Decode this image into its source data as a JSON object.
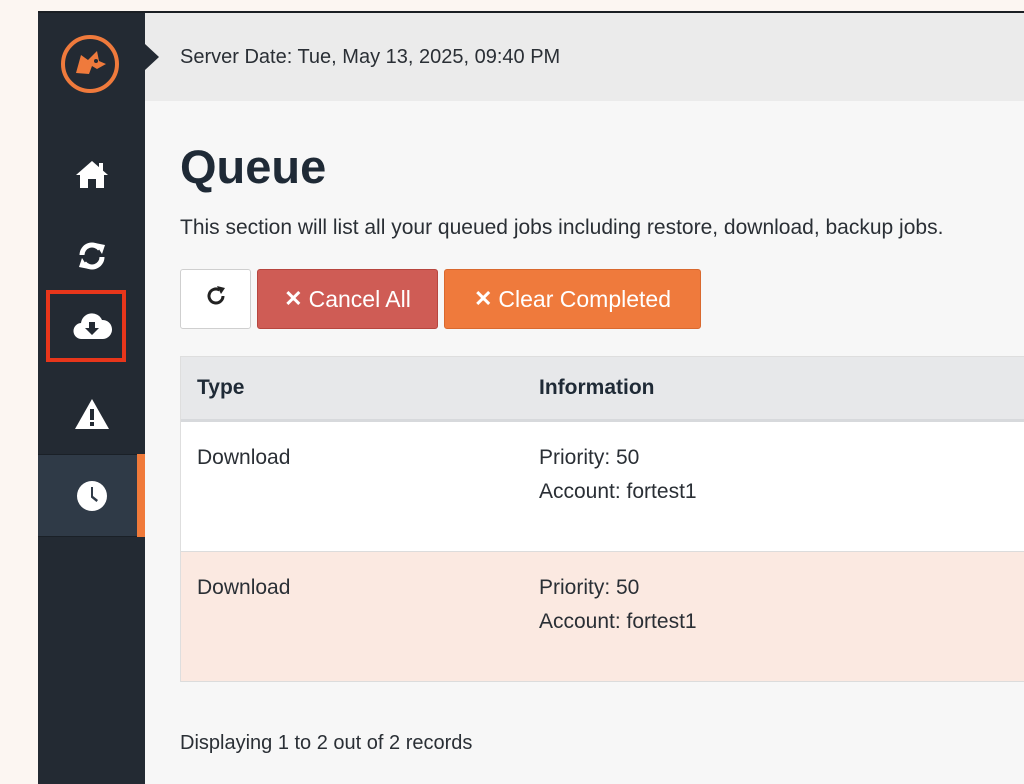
{
  "header": {
    "server_date": "Server Date: Tue, May 13, 2025, 09:40 PM"
  },
  "sidebar": {
    "logo_icon": "fox-logo-icon",
    "items": [
      {
        "icon": "home-icon"
      },
      {
        "icon": "sync-icon"
      },
      {
        "icon": "cloud-download-icon",
        "highlighted": true
      },
      {
        "icon": "warning-icon"
      },
      {
        "icon": "clock-icon",
        "active": true
      }
    ]
  },
  "page": {
    "title": "Queue",
    "description": "This section will list all your queued jobs including restore, download, backup jobs."
  },
  "toolbar": {
    "refresh_icon": "refresh-icon",
    "cancel_all_label": "Cancel All",
    "clear_completed_label": "Clear Completed"
  },
  "table": {
    "headers": [
      "Type",
      "Information"
    ],
    "rows": [
      {
        "type": "Download",
        "priority": "Priority: 50",
        "account": "Account: fortest1"
      },
      {
        "type": "Download",
        "priority": "Priority: 50",
        "account": "Account: fortest1"
      }
    ]
  },
  "footer": {
    "records": "Displaying 1 to 2 out of 2 records"
  },
  "colors": {
    "sidebar_bg": "#232a33",
    "accent_orange": "#ef7a3c",
    "danger_red": "#cf5c55",
    "highlight_border": "#e8361b"
  }
}
